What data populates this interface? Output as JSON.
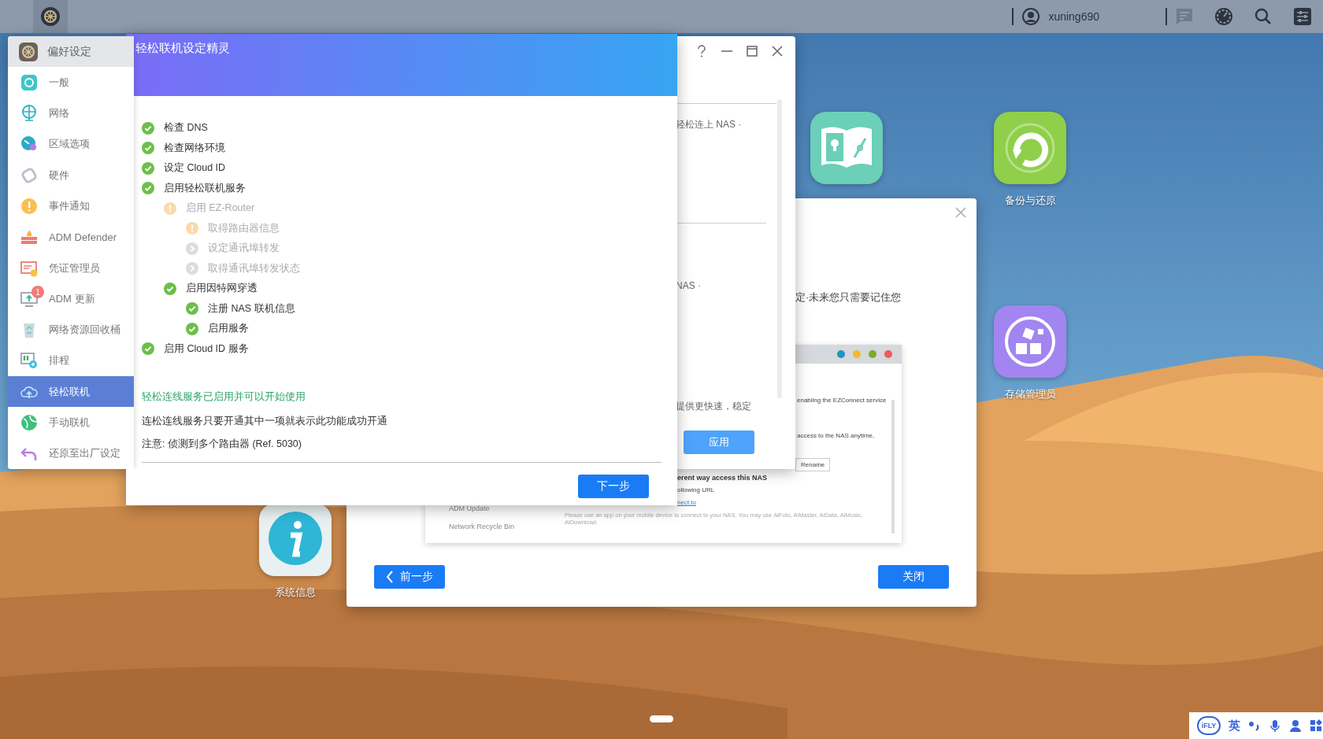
{
  "top_bar": {
    "user": "xuning690"
  },
  "desktop_icons": [
    {
      "kind": "help"
    },
    {
      "kind": "backup",
      "label": "备份与还原"
    },
    {
      "kind": "storage",
      "label": "存储管理员"
    },
    {
      "kind": "info",
      "label": "系统信息"
    }
  ],
  "preferences": {
    "title": "偏好设定",
    "sidebar": [
      {
        "label": "一般",
        "kind": "general",
        "selected": false
      },
      {
        "label": "网络",
        "kind": "network",
        "selected": false
      },
      {
        "label": "区域选项",
        "kind": "region",
        "selected": false
      },
      {
        "label": "硬件",
        "kind": "hardware",
        "selected": false
      },
      {
        "label": "事件通知",
        "kind": "notification",
        "selected": false
      },
      {
        "label": "ADM Defender",
        "kind": "defender",
        "selected": false
      },
      {
        "label": "凭证管理员",
        "kind": "certificate",
        "selected": false
      },
      {
        "label": "ADM 更新",
        "kind": "update",
        "selected": false,
        "badge": "1"
      },
      {
        "label": "网络资源回收桶",
        "kind": "recycle",
        "selected": false
      },
      {
        "label": "排程",
        "kind": "schedule",
        "selected": false
      },
      {
        "label": "轻松联机",
        "kind": "cloud",
        "selected": true
      },
      {
        "label": "手动联机",
        "kind": "globe",
        "selected": false
      },
      {
        "label": "还原至出厂设定",
        "kind": "restore",
        "selected": false
      }
    ],
    "content": [
      "轻松连上 NAS ·",
      "NAS ·",
      "提供更快速，稳定"
    ],
    "apply_button": "应用"
  },
  "overview_dialog": {
    "text": "定·未来您只需要记住您",
    "screenshot": {
      "sidebar": [
        "ADM Update",
        "Network Recycle Bin"
      ],
      "line_1": "enabling the EZConnect service",
      "line_2": "access to the NAS anytime,",
      "rename_button": "Rename",
      "heading": "erent way access this NAS",
      "line_3": "ollowing URL",
      "link": "nect.to",
      "paragraph": "Please use an app on your mobile device to connect to your NAS. You may use AiFoto, AiMaster, AiData, AiMusic, AiDownload."
    },
    "back_button": "前一步",
    "close_button": "关闭"
  },
  "wizard": {
    "title": "轻松联机设定精灵",
    "steps": [
      {
        "label": "检查 DNS",
        "kind": "ok",
        "disabled": false
      },
      {
        "label": "检查网络环境",
        "kind": "ok",
        "disabled": false
      },
      {
        "label": "设定 Cloud ID",
        "kind": "ok",
        "disabled": false
      },
      {
        "label": "启用轻松联机服务",
        "kind": "ok",
        "disabled": false,
        "children": [
          {
            "label": "启用 EZ-Router",
            "kind": "warning",
            "disabled": true,
            "children": [
              {
                "label": "取得路由器信息",
                "kind": "warning",
                "disabled": true
              },
              {
                "label": "设定通讯埠转发",
                "kind": "pending",
                "disabled": true
              },
              {
                "label": "取得通讯埠转发状态",
                "kind": "pending",
                "disabled": true
              }
            ]
          },
          {
            "label": "启用因特网穿透",
            "kind": "ok",
            "disabled": false,
            "children": [
              {
                "label": "注册 NAS 联机信息",
                "kind": "ok",
                "disabled": false
              },
              {
                "label": "启用服务",
                "kind": "ok",
                "disabled": false
              }
            ]
          }
        ]
      },
      {
        "label": "启用 Cloud ID 服务",
        "kind": "ok",
        "disabled": false
      }
    ],
    "success": "轻松连线服务已启用并可以开始使用",
    "notes": [
      "连松连线服务只要开通其中一项就表示此功能成功开通",
      "注意: 侦测到多个路由器 (Ref. 5030)"
    ],
    "next_button": "下一步"
  },
  "ime_bar": {
    "logo": "iFLY",
    "language": "英"
  }
}
